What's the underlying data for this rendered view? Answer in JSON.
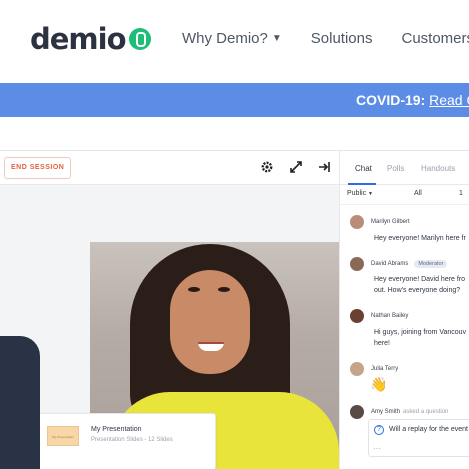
{
  "nav": {
    "logo_text": "demio",
    "links": [
      {
        "label": "Why Demio?",
        "has_dropdown": true
      },
      {
        "label": "Solutions",
        "has_dropdown": false
      },
      {
        "label": "Customers",
        "has_dropdown": false
      }
    ]
  },
  "banner": {
    "prefix": "COVID-19:",
    "link_text": "Read C",
    "color": "#5b8de6"
  },
  "toolbar": {
    "end_session_label": "END SESSION",
    "icons": [
      "gear-icon",
      "expand-icon",
      "exit-icon"
    ]
  },
  "presentation": {
    "thumb_text": "My Presentation",
    "title": "My Presentation",
    "subtitle": "Presentation Slides - 12 Slides"
  },
  "chat": {
    "tabs": [
      "Chat",
      "Polls",
      "Handouts"
    ],
    "active_tab": "Chat",
    "filter_label": "Public",
    "filter_all": "All",
    "filter_count": "1",
    "messages": [
      {
        "name": "Marilyn Gilbert",
        "text": "Hey everyone! Marilyn here fr",
        "avatar_color": "#b98d7a"
      },
      {
        "name": "David Abrams",
        "badge": "Moderator",
        "text": "Hey everyone! David here fro\nout. How's everyone doing?",
        "avatar_color": "#8a6a56"
      },
      {
        "name": "Nathan Bailey",
        "text": "Hi guys, joining from Vancouv\nhere!",
        "avatar_color": "#6b3f32"
      },
      {
        "name": "Julia Terry",
        "emoji": "👋",
        "avatar_color": "#c5a48c"
      },
      {
        "name": "Amy Smith",
        "asked": "asked a question",
        "question": "Will a replay for the event",
        "more": "···",
        "avatar_color": "#5a4a44"
      }
    ]
  },
  "colors": {
    "accent_blue": "#2b6fe0",
    "end_session_red": "#e3603e",
    "logo_green": "#1fbd77",
    "shirt_yellow": "#e9e43a"
  }
}
